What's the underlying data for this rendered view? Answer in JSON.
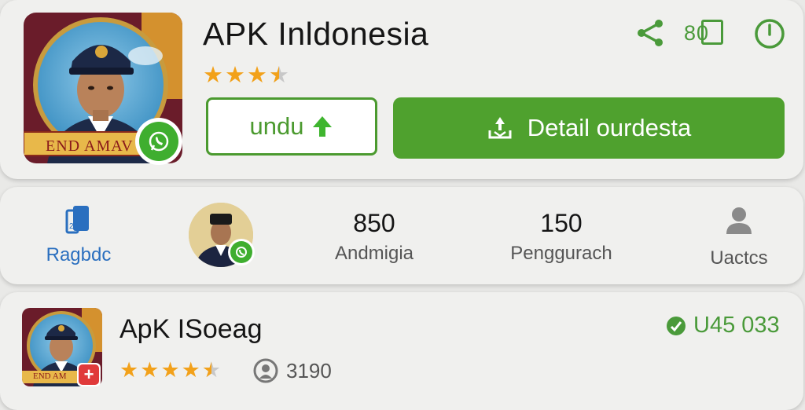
{
  "app": {
    "title": "APK Inldonesia",
    "icon_banner": "END AMAV",
    "rating_stars": 3.5,
    "header_count": "80",
    "icons": {
      "share": "share-icon",
      "count": "count-badge-icon",
      "power": "power-icon"
    },
    "buttons": {
      "secondary_label": "undu",
      "primary_label": "Detail ourdesta"
    }
  },
  "stats": {
    "ragbdc_label": "Ragbdc",
    "stat1_value": "850",
    "stat1_label": "Andmigia",
    "stat2_value": "150",
    "stat2_label": "Penggurach",
    "users_label": "Uactcs"
  },
  "related": {
    "title": "ApK ISoeag",
    "icon_banner": "END AM",
    "rating_stars": 4.5,
    "downloads": "3190",
    "price": "U45 033"
  },
  "colors": {
    "accent_green": "#4fa12e",
    "star": "#f2a11a",
    "link_blue": "#2a6fbf"
  }
}
